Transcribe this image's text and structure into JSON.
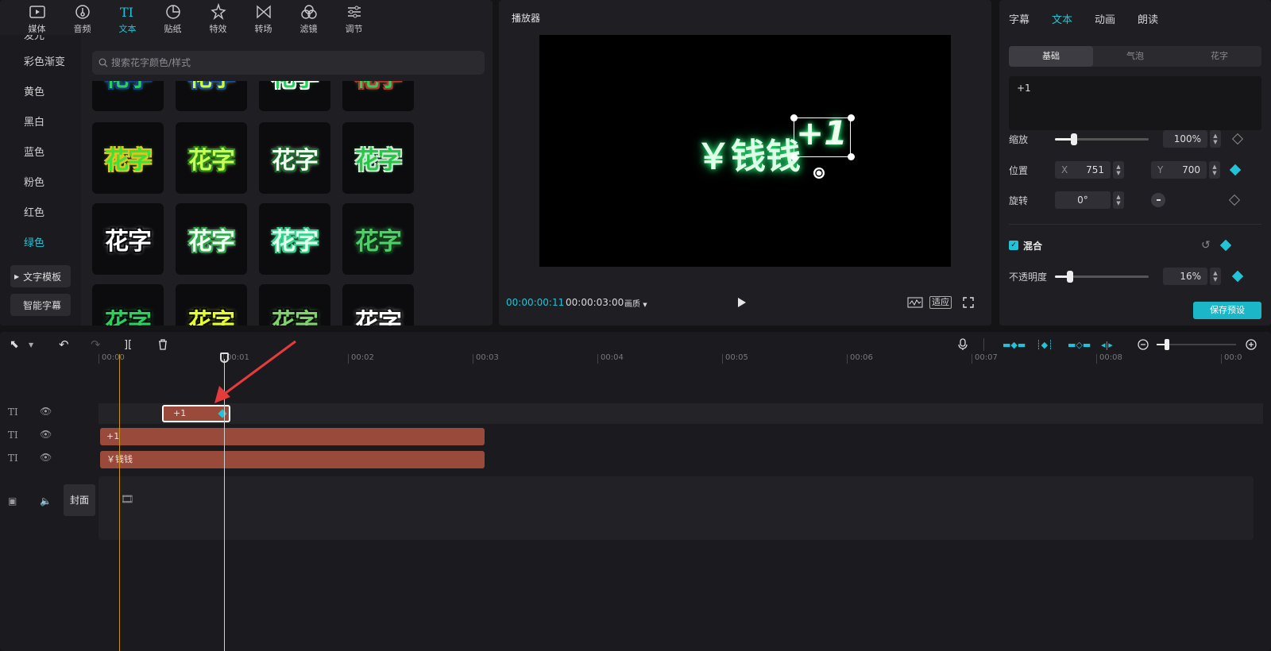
{
  "library": {
    "tabs": [
      {
        "label": "媒体",
        "icon": "media-icon"
      },
      {
        "label": "音频",
        "icon": "audio-icon"
      },
      {
        "label": "文本",
        "icon": "text-icon"
      },
      {
        "label": "贴纸",
        "icon": "sticker-icon"
      },
      {
        "label": "特效",
        "icon": "effects-icon"
      },
      {
        "label": "转场",
        "icon": "transition-icon"
      },
      {
        "label": "滤镜",
        "icon": "filter-icon"
      },
      {
        "label": "调节",
        "icon": "adjust-icon"
      }
    ],
    "active_tab": "文本",
    "categories": [
      "发光",
      "彩色渐变",
      "黄色",
      "黑白",
      "蓝色",
      "粉色",
      "红色",
      "绿色"
    ],
    "active_category": "绿色",
    "category_buttons": [
      "文字模板",
      "智能字幕"
    ],
    "search_placeholder": "搜索花字颜色/样式",
    "tile_text": "花字",
    "tiles": [
      {
        "color": "#28d25a",
        "stroke": "#1b3a8a"
      },
      {
        "color": "#c8ff30",
        "stroke": "#1b4aa8"
      },
      {
        "color": "#28d25a",
        "stroke": "#ffffff"
      },
      {
        "color": "#28d25a",
        "stroke": "#c03030"
      },
      {
        "color": "#39e43a",
        "stroke": "#e7c320"
      },
      {
        "color": "#c8ff50",
        "stroke": "#2a8a1e"
      },
      {
        "color": "#f2fff2",
        "stroke": "#1a6a2a"
      },
      {
        "color": "#23c84a",
        "stroke": "#cfe8cf"
      },
      {
        "color": "#ffffff",
        "stroke": "#0c0c0e"
      },
      {
        "color": "#f4fff4",
        "stroke": "#2eaa4a"
      },
      {
        "color": "#e9fff0",
        "stroke": "#2bd487"
      },
      {
        "color": "#4fcf68",
        "stroke": "#0f3a1a"
      },
      {
        "color": "#28d25a",
        "stroke": "#0c0c0e"
      },
      {
        "color": "#e6ff2a",
        "stroke": "#0c0c0e"
      },
      {
        "color": "#7fd36a",
        "stroke": "#0c0c0e"
      },
      {
        "color": "#ffffff",
        "stroke": "#1a1a1a"
      }
    ]
  },
  "player": {
    "title": "播放器",
    "video_text": "￥钱钱",
    "video_plus": "+1",
    "current_time": "00:00:00:11",
    "total_time": "00:00:03:00",
    "quality_label": "画质",
    "fit_label": "适应"
  },
  "inspector": {
    "tabs": [
      "字幕",
      "文本",
      "动画",
      "朗读"
    ],
    "active_tab": "文本",
    "segments": [
      "基础",
      "气泡",
      "花字"
    ],
    "active_segment": "基础",
    "text_value": "+1",
    "scale_label": "缩放",
    "scale_value": "100%",
    "scale_level": 0.2,
    "position_label": "位置",
    "x_label": "X",
    "x_value": "751",
    "y_label": "Y",
    "y_value": "700",
    "rotate_label": "旋转",
    "rotate_value": "0°",
    "blend_label": "混合",
    "opacity_label": "不透明度",
    "opacity_value": "16%",
    "opacity_level": 0.16,
    "save_preset": "保存预设",
    "accent": "#22c3d6"
  },
  "timeline": {
    "ruler_labels": [
      "00:00",
      "00:01",
      "00:02",
      "00:03",
      "00:04",
      "00:05",
      "00:06",
      "00:07",
      "00:08",
      "00:0"
    ],
    "clips": {
      "track1": "+1",
      "track2": "+1",
      "track3": "￥钱钱"
    },
    "cover_label": "封面",
    "clip_color": "#9a4a3a",
    "playhead_color": "#d0d0d0",
    "marker_color": "#c8941e"
  }
}
